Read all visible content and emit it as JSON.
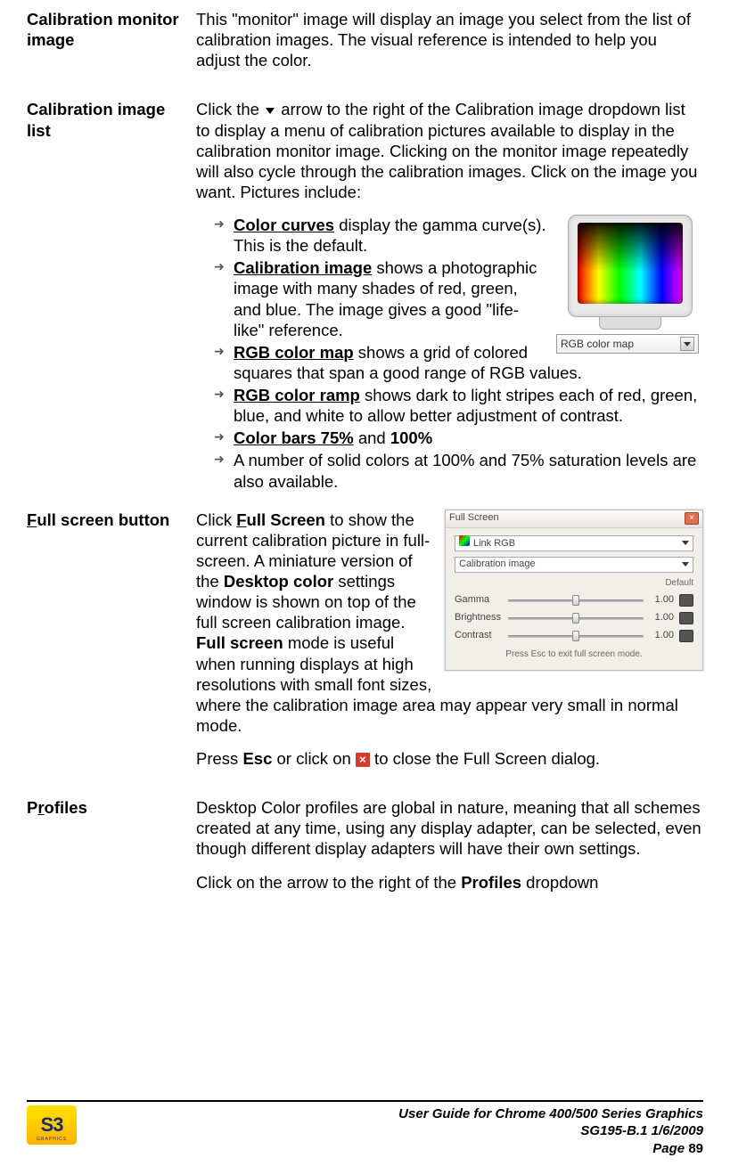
{
  "sections": {
    "s1": {
      "label": "Calibration monitor image",
      "para": "This \"monitor\" image will display an image you select from the list of calibration images. The visual reference is intended to help you adjust the color."
    },
    "s2": {
      "label": "Calibration image list",
      "intro_a": "Click the ",
      "intro_b": " arrow to the right of the Calibration image dropdown list to display a menu of calibration pictures available to display in the calibration monitor image. Clicking on the monitor image repeatedly will also cycle through the calibration images. Click on the image you want. Pictures include:",
      "bullets": {
        "b1": {
          "bold": "Color curves",
          "rest": " display the gamma curve(s). This is the default."
        },
        "b2": {
          "bold": "Calibration image",
          "rest": " shows a photographic image with many shades of red, green, and blue. The image gives a good \"life-like\" reference."
        },
        "b3": {
          "bold": "RGB color map",
          "rest": " shows a grid of colored squares that span a good range of RGB values."
        },
        "b4": {
          "bold": "RGB color ramp",
          "rest": " shows dark to light stripes each of red, green, blue, and white to allow better adjustment of contrast."
        },
        "b5": {
          "bold1": "Color bars 75%",
          "mid": " and ",
          "bold2": "100%"
        },
        "b6": {
          "text": "A number of solid colors at 100% and 75% saturation levels are also available."
        }
      },
      "dropdown_label": "RGB color map"
    },
    "s3": {
      "label": "Full screen button",
      "label_underline_char": "F",
      "p_a": "Click ",
      "p_bold_underline": "Full Screen",
      "p_b": " to show the current calibration picture in full-screen. A miniature version of the ",
      "p_bold2": "Desktop color",
      "p_c": " settings window is shown on top of the full screen calibration image. ",
      "p_bold3": "Full screen",
      "p_d": " mode is useful when running displays at high resolutions with small font sizes, where the calibration image area may appear very small in normal mode.",
      "p2_a": "Press ",
      "p2_bold": "Esc",
      "p2_b": " or click on ",
      "p2_c": " to close the Full Screen dialog.",
      "dialog": {
        "title": "Full Screen",
        "link_rgb": "Link RGB",
        "cal_image": "Calibration image",
        "default": "Default",
        "rows": {
          "gamma": {
            "label": "Gamma",
            "value": "1.00"
          },
          "brightness": {
            "label": "Brightness",
            "value": "1.00"
          },
          "contrast": {
            "label": "Contrast",
            "value": "1.00"
          }
        },
        "footer": "Press Esc to exit full screen mode."
      }
    },
    "s4": {
      "label_char": "P",
      "label_u": "r",
      "label_rest": "ofiles",
      "para": "Desktop Color profiles are global in nature, meaning that all schemes created at any time, using any display adapter, can be selected, even though different display adapters will have their own settings.",
      "p2_a": "Click on the arrow to the right of the ",
      "p2_bold": "Profiles",
      "p2_b": " dropdown"
    }
  },
  "footer": {
    "logo_main": "S3",
    "logo_sub": "GRAPHICS",
    "line1": "User Guide for Chrome 400/500 Series Graphics",
    "line2": "SG195-B.1   1/6/2009",
    "line3_a": "Page ",
    "line3_b": "89"
  }
}
